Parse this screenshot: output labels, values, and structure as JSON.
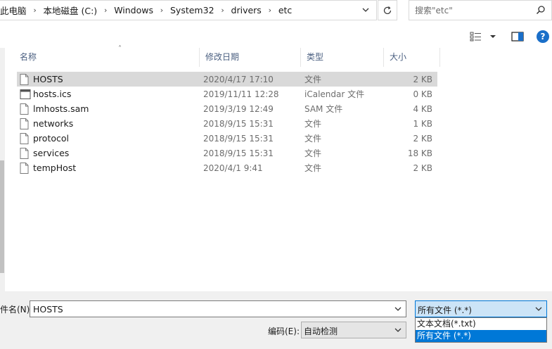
{
  "address": {
    "crumbs": [
      "此电脑",
      "本地磁盘 (C:)",
      "Windows",
      "System32",
      "drivers",
      "etc"
    ]
  },
  "search": {
    "placeholder": "搜索\"etc\""
  },
  "list": {
    "columns": {
      "name": "名称",
      "date": "修改日期",
      "type": "类型",
      "size": "大小"
    },
    "rows": [
      {
        "name": "HOSTS",
        "date": "2020/4/17 17:10",
        "type": "文件",
        "size": "2 KB",
        "icon": "file-icon",
        "selected": true
      },
      {
        "name": "hosts.ics",
        "date": "2019/11/11 12:28",
        "type": "iCalendar 文件",
        "size": "0 KB",
        "icon": "calendar-file-icon"
      },
      {
        "name": "lmhosts.sam",
        "date": "2019/3/19 12:49",
        "type": "SAM 文件",
        "size": "4 KB",
        "icon": "file-icon"
      },
      {
        "name": "networks",
        "date": "2018/9/15 15:31",
        "type": "文件",
        "size": "1 KB",
        "icon": "file-icon"
      },
      {
        "name": "protocol",
        "date": "2018/9/15 15:31",
        "type": "文件",
        "size": "2 KB",
        "icon": "file-icon"
      },
      {
        "name": "services",
        "date": "2018/9/15 15:31",
        "type": "文件",
        "size": "18 KB",
        "icon": "file-icon"
      },
      {
        "name": "tempHost",
        "date": "2020/4/1 9:41",
        "type": "文件",
        "size": "2 KB",
        "icon": "file-icon"
      }
    ]
  },
  "bottom": {
    "filename_label": "件名(N):",
    "filename_value": "HOSTS",
    "filetype_value": "所有文件  (*.*)",
    "filetype_options": [
      "文本文档(*.txt)",
      "所有文件  (*.*)"
    ],
    "encoding_label": "编码(E):",
    "encoding_value": "自动检测"
  },
  "toolbar": {
    "help_label": "?"
  },
  "colors": {
    "accent": "#0078d7",
    "selection": "#d9d9d9",
    "help": "#1a6fc9"
  }
}
